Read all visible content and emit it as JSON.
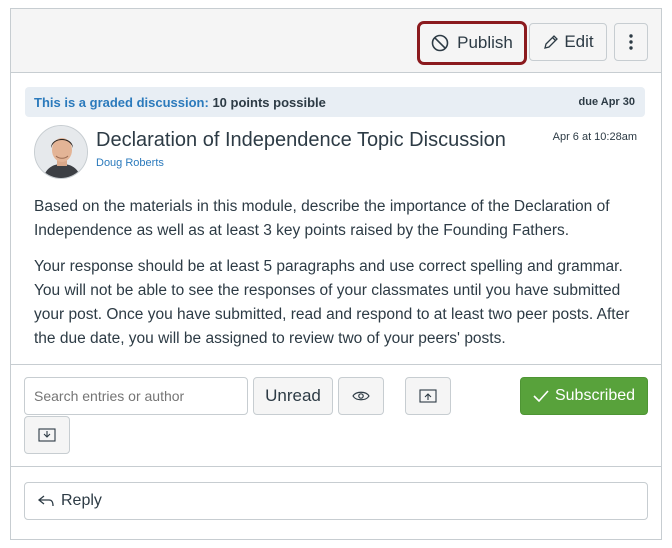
{
  "toolbar": {
    "publish_label": "Publish",
    "edit_label": "Edit",
    "highlight_color": "#8b1a1e"
  },
  "grade_bar": {
    "label": "This is a graded discussion:",
    "points": "10 points possible",
    "due": "due Apr 30"
  },
  "discussion": {
    "title": "Declaration of Independence Topic Discussion",
    "author": "Doug Roberts",
    "date": "Apr 6 at 10:28am",
    "paragraphs": [
      "Based on the materials in this module, describe the importance of the Declaration of Independence as well as at least 3 key points raised by the Founding Fathers.",
      "Your response should be at least 5 paragraphs and use correct spelling and grammar. You will not be able to see the responses of your classmates until you have submitted your post. Once you have submitted, read and respond to at least two peer posts. After the due date, you will be assigned to review two of your peers' posts."
    ]
  },
  "filters": {
    "search_placeholder": "Search entries or author",
    "unread_label": "Unread",
    "subscribed_label": "Subscribed",
    "subscribed_color": "#58a23b"
  },
  "reply": {
    "label": "Reply"
  },
  "icons": [
    "ban-icon",
    "pencil-icon",
    "kebab-icon",
    "eye-icon",
    "collapse-icon",
    "expand-icon",
    "checkmark-icon",
    "reply-arrow-icon"
  ]
}
